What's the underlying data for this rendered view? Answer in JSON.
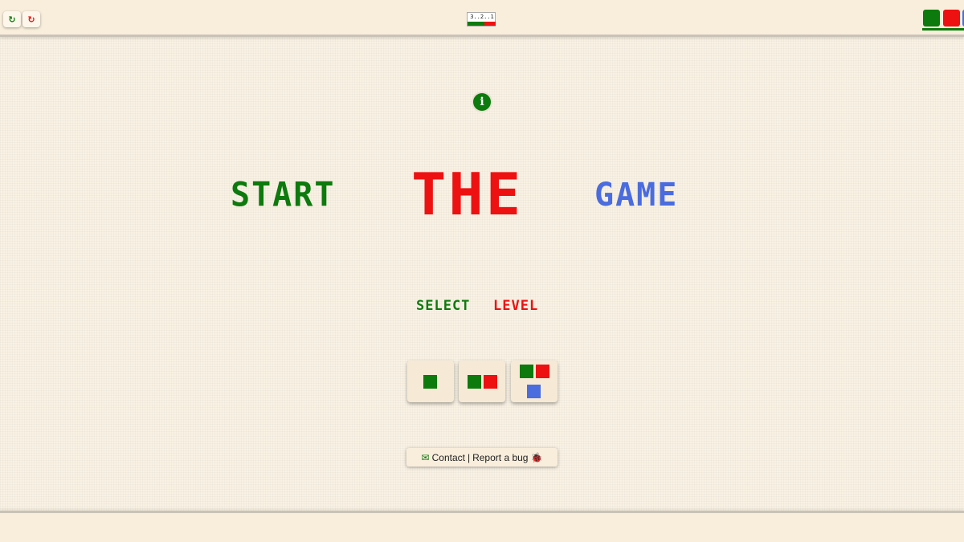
{
  "toolbar": {
    "left_buttons": [
      {
        "icon": "green-refresh-icon",
        "glyph": "↻",
        "color": "#0d7a0d"
      },
      {
        "icon": "red-refresh-icon",
        "glyph": "↻",
        "color": "#ee1111"
      }
    ],
    "logo_text": "3..2..1"
  },
  "title": {
    "word1": "START",
    "word2": "THE",
    "word3": "GAME"
  },
  "level_select": {
    "label_part1": "SELECT",
    "label_part2": "LEVEL",
    "levels": [
      {
        "squares": [
          "green"
        ]
      },
      {
        "squares": [
          "green",
          "red"
        ]
      },
      {
        "squares": [
          "green",
          "red",
          "blue"
        ]
      }
    ]
  },
  "footer": {
    "contact_label": "Contact",
    "separator": "|",
    "bug_label": "Report a bug"
  },
  "colors": {
    "green": "#0d7a0d",
    "red": "#ee1111",
    "blue": "#4b6cdf",
    "background": "#f9f2e4"
  }
}
